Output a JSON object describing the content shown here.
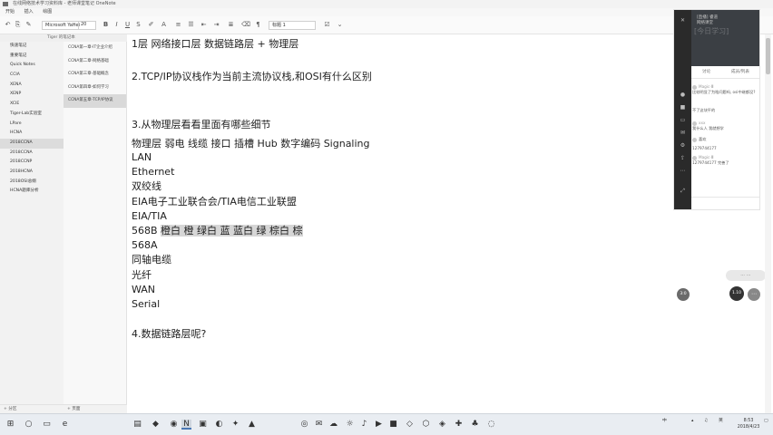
{
  "window": {
    "title": "在线网络技术学习资料库 - 老师课堂笔记 OneNote"
  },
  "menu": [
    "开始",
    "插入",
    "绘图"
  ],
  "toolbar": {
    "font": "Microsoft YaHei",
    "size": "20",
    "style": "标题 1"
  },
  "notebook_header": "Tiger 的笔记本",
  "notebooks": [
    "快速笔记",
    "重要笔记",
    "Quick Notes",
    "CCIA",
    "XENA",
    "XENP",
    "XCIE",
    "Tiger-Lab实验室",
    "LPare",
    "HCNA",
    "2018CCNA",
    "2018CCNA",
    "2018CCNP",
    "2018HCNA",
    "2018OSI总纲",
    "HCNA题库分析"
  ],
  "notebooks_selected_index": 10,
  "sections": [
    "CCNA第一章-IT企业介绍",
    "CCNA第二章-网络基础",
    "CCNA第三章-基础概念",
    "CCNA第四章-如何学习",
    "CCNA第五章-TCP/IP协议"
  ],
  "sections_selected_index": 4,
  "left_footer": {
    "add_section": "+ 分区",
    "add_page": "+ 页面"
  },
  "note_lines": [
    "1层 网络接口层        数据链路层 + 物理层",
    "2.TCP/IP协议栈作为当前主流协议栈,和OSI有什么区别",
    "3.从物理层看看里面有哪些细节",
    "物理层 弱电 线缆 接口  插槽  Hub 数字编码 Signaling",
    "LAN",
    "Ethernet",
    "双绞线",
    "EIA电子工业联合会/TIA电信工业联盟",
    "EIA/TIA",
    "568B",
    "568A",
    "同轴电缆",
    "光纤",
    "WAN",
    "Serial",
    "4.数据链路层呢?"
  ],
  "note_568b_highlight": "橙白 橙 绿白 蓝 蓝白 绿 棕白 棕",
  "right_panel": {
    "video_caption": "[直播] 睿道\n网络课堂",
    "watermark": "[今日学习]",
    "tabs": [
      "讨论",
      "成员/列表"
    ],
    "chat": [
      {
        "name": "Magic·Ⅲ",
        "text": "比较明显了为啥问题吗, osi中继都没?"
      },
      {
        "name": "",
        "text": "不了这块平的"
      },
      {
        "name": "xxx",
        "text": "我什么人 我就想学"
      },
      {
        "name": "",
        "text": "喜欢"
      },
      {
        "name": "",
        "text": "1279744177"
      },
      {
        "name": "Magic·Ⅲ",
        "text": "1279744177 完善了"
      }
    ]
  },
  "float": {
    "pill": "⋯  ⋯",
    "btn_left": "3:0",
    "btn_right": "1.10"
  },
  "taskbar": {
    "tray_time": "8:53",
    "tray_date": "2018/4/23",
    "tray_ime": "中",
    "tray_lang": "英"
  }
}
